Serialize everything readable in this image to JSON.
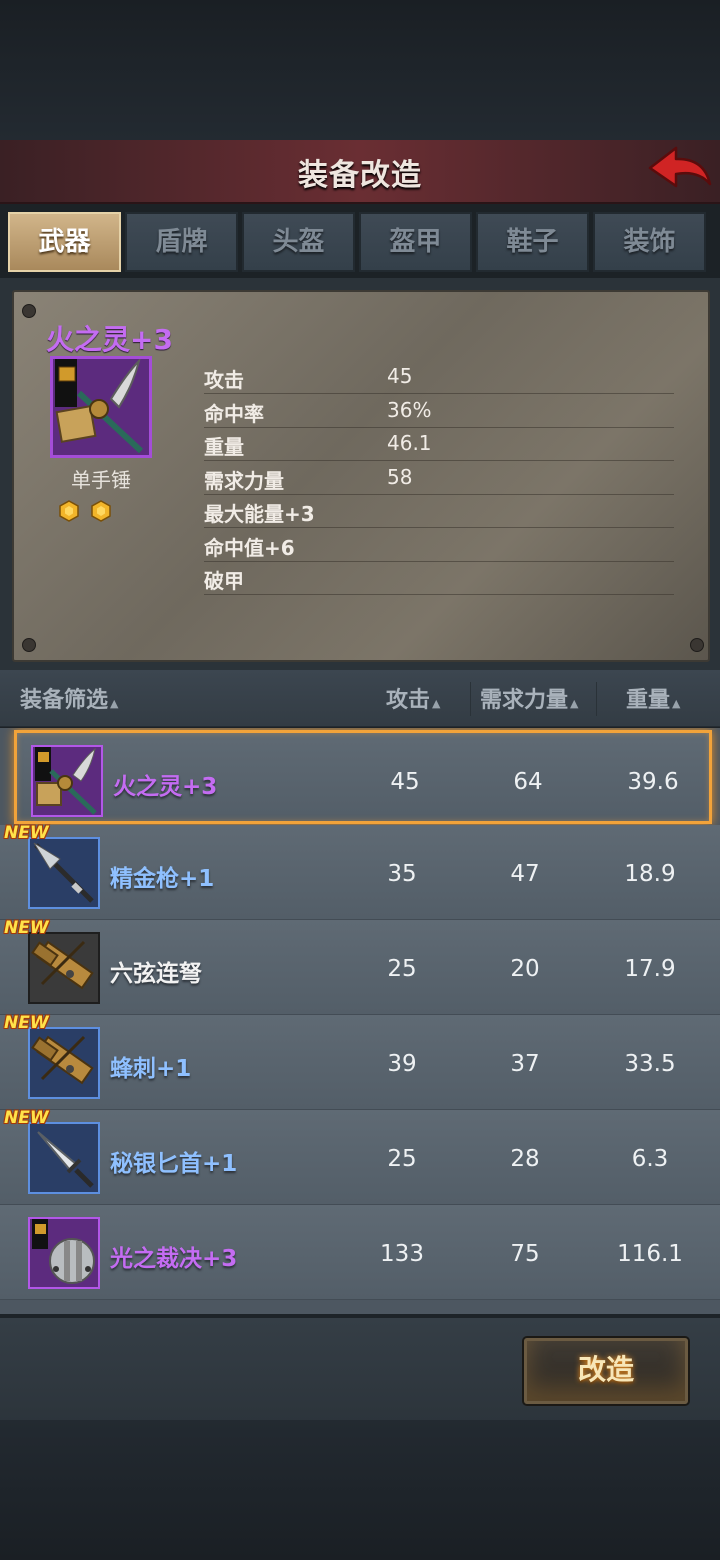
{
  "title": "装备改造",
  "tabs": [
    "武器",
    "盾牌",
    "头盔",
    "盔甲",
    "鞋子",
    "装饰"
  ],
  "active_tab": 0,
  "selected_item": {
    "name": "火之灵+3",
    "type": "单手锤",
    "gems": 2,
    "stats": [
      {
        "label": "攻击",
        "value": "45"
      },
      {
        "label": "命中率",
        "value": "36%"
      },
      {
        "label": "重量",
        "value": "46.1"
      },
      {
        "label": "需求力量",
        "value": "58"
      },
      {
        "label": "最大能量+3",
        "value": ""
      },
      {
        "label": "命中值+6",
        "value": ""
      },
      {
        "label": "破甲",
        "value": ""
      }
    ]
  },
  "list_header": {
    "filter": "装备筛选",
    "attack": "攻击",
    "strength": "需求力量",
    "weight": "重量"
  },
  "items": [
    {
      "name": "火之灵+3",
      "attack": "45",
      "strength": "64",
      "weight": "39.6",
      "rarity": "purple",
      "new": false,
      "selected": true,
      "icon": "hammer-icon"
    },
    {
      "name": "精金枪+1",
      "attack": "35",
      "strength": "47",
      "weight": "18.9",
      "rarity": "blue",
      "new": true,
      "selected": false,
      "icon": "spear-icon"
    },
    {
      "name": "六弦连弩",
      "attack": "25",
      "strength": "20",
      "weight": "17.9",
      "rarity": "white",
      "new": true,
      "selected": false,
      "icon": "crossbow-icon"
    },
    {
      "name": "蜂刺+1",
      "attack": "39",
      "strength": "37",
      "weight": "33.5",
      "rarity": "blue",
      "new": true,
      "selected": false,
      "icon": "crossbow-icon"
    },
    {
      "name": "秘银匕首+1",
      "attack": "25",
      "strength": "28",
      "weight": "6.3",
      "rarity": "blue",
      "new": true,
      "selected": false,
      "icon": "dagger-icon"
    },
    {
      "name": "光之裁决+3",
      "attack": "133",
      "strength": "75",
      "weight": "116.1",
      "rarity": "purple",
      "new": false,
      "selected": false,
      "icon": "mace-icon"
    }
  ],
  "new_label": "NEW",
  "reforge_button": "改造",
  "colors": {
    "purple": "#c46cf2",
    "blue": "#8fc0ff",
    "white": "#f2f2f2",
    "selection": "#f2a33a"
  }
}
